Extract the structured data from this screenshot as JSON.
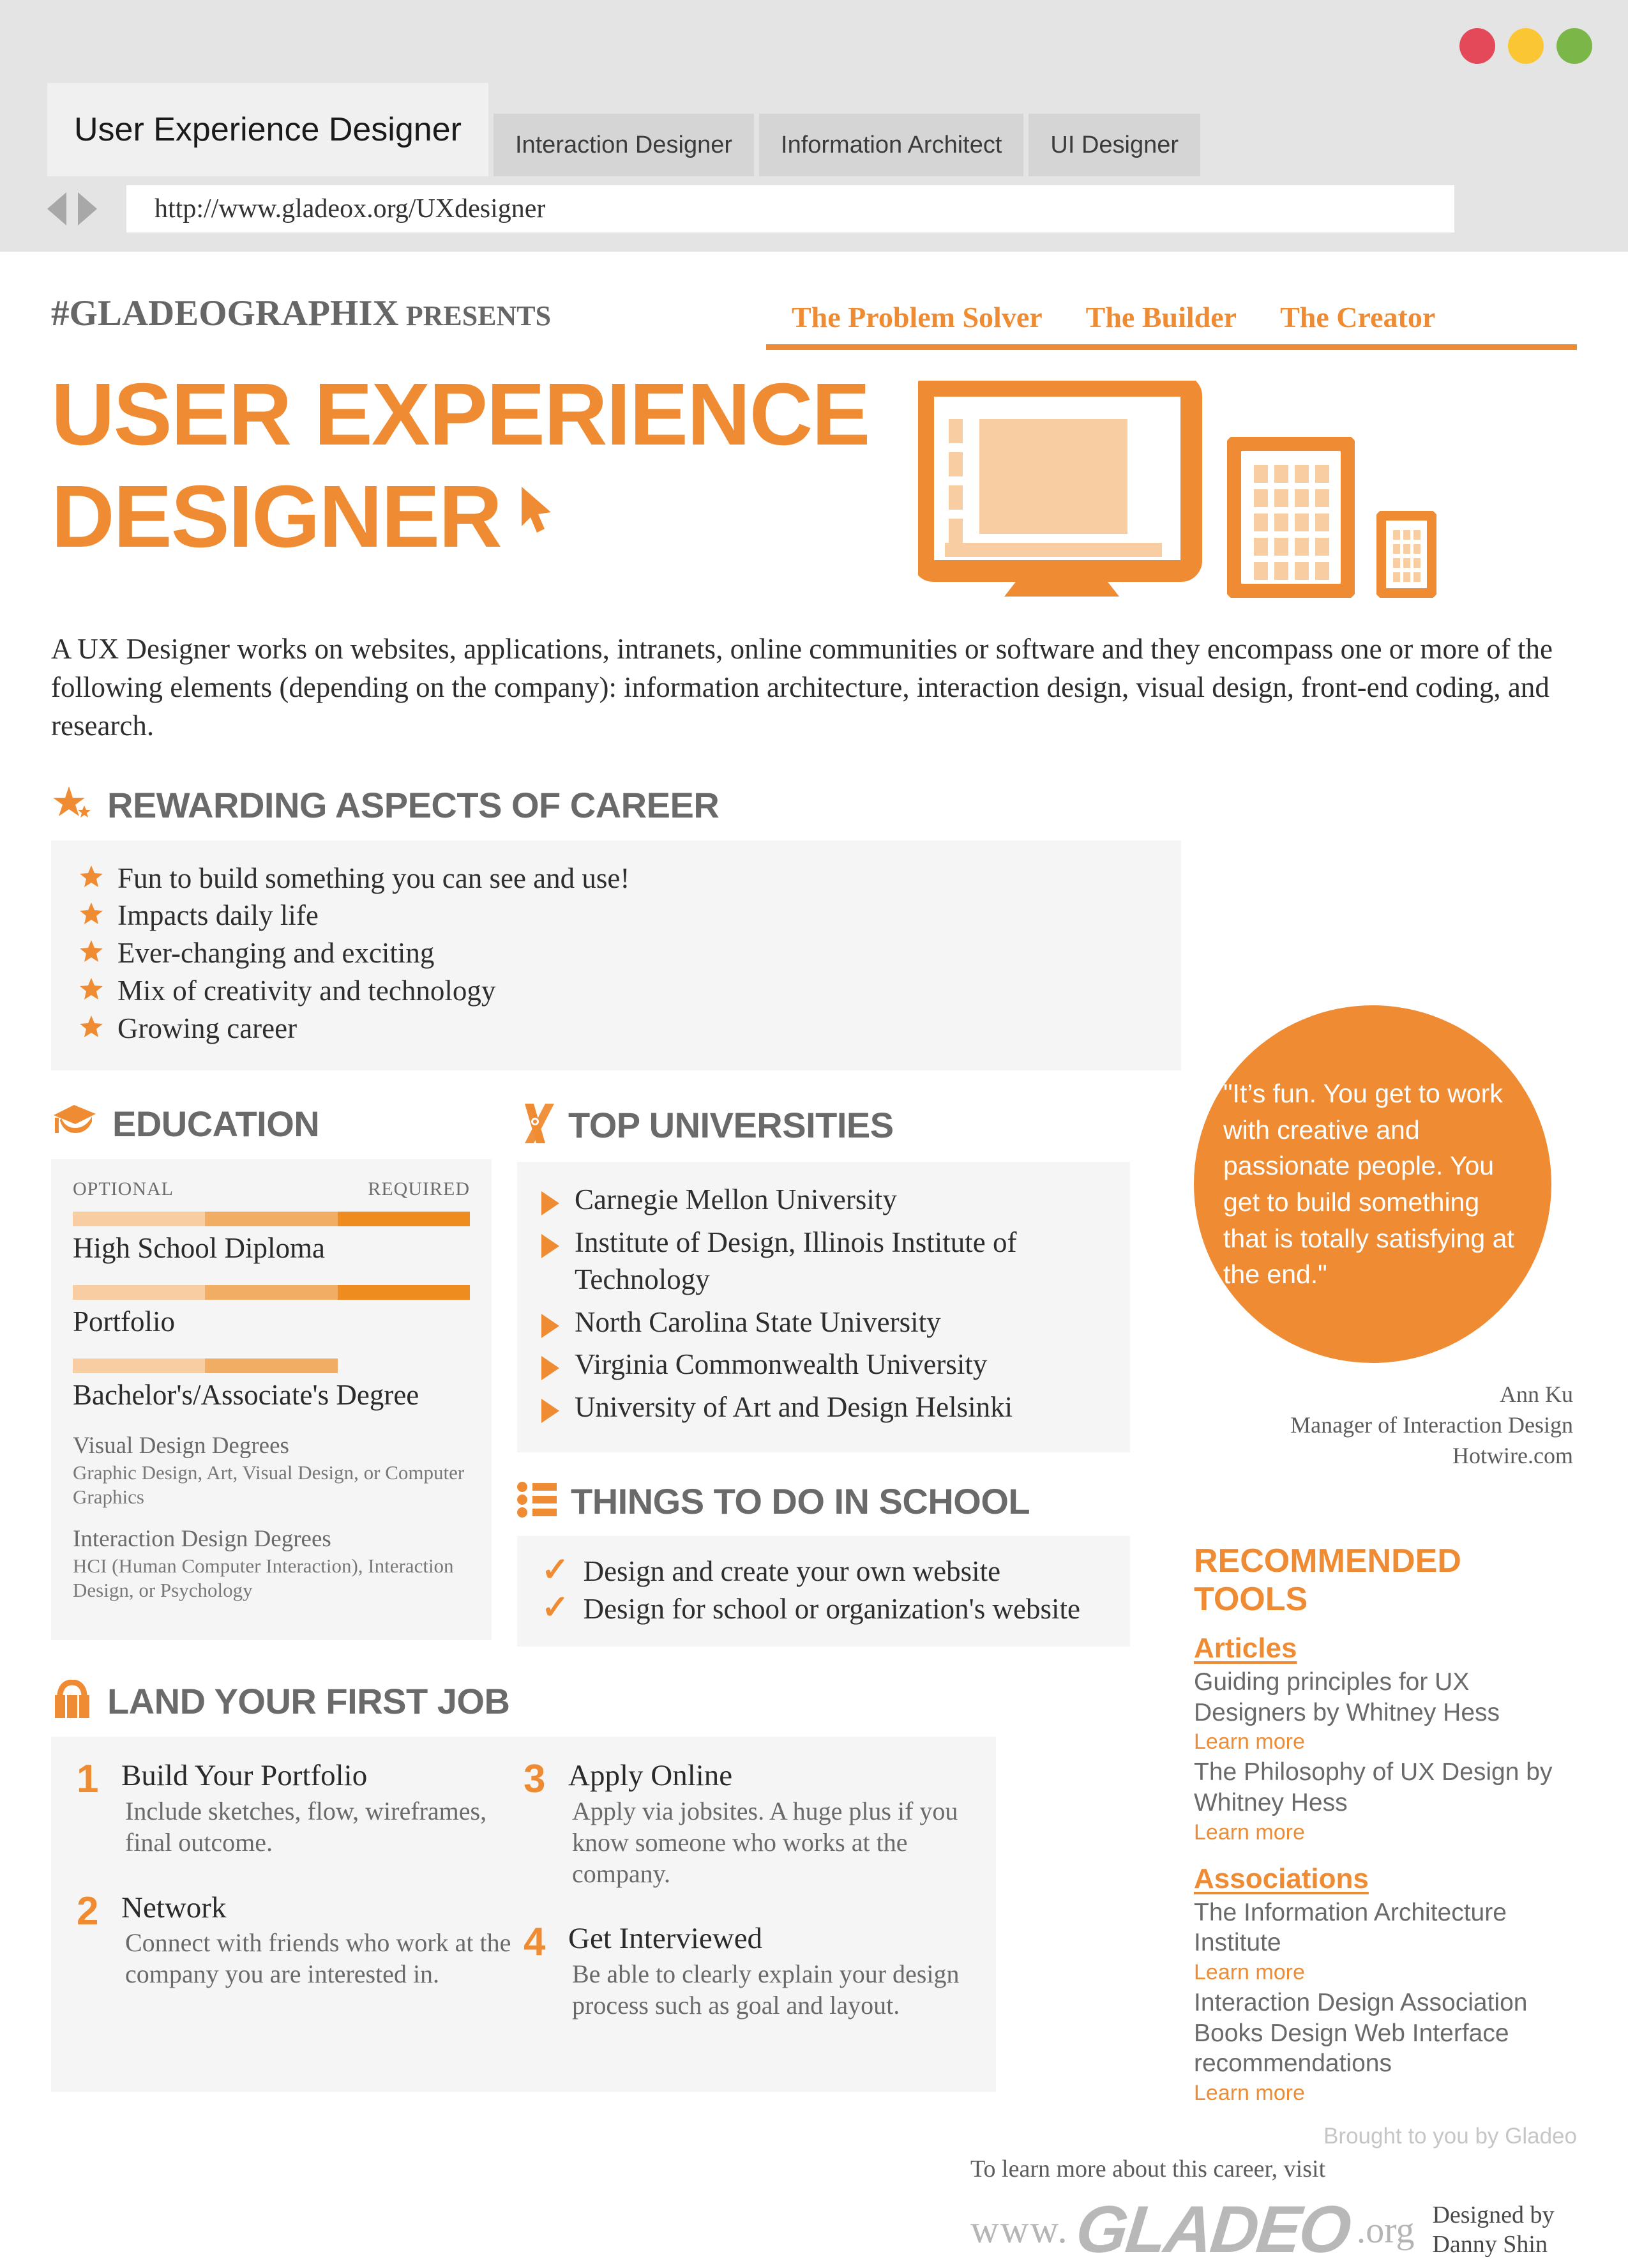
{
  "browser": {
    "tabs": [
      {
        "label": "User Experience Designer",
        "active": true
      },
      {
        "label": "Interaction Designer",
        "active": false
      },
      {
        "label": "Information Architect",
        "active": false
      },
      {
        "label": "UI Designer",
        "active": false
      }
    ],
    "url": "http://www.gladeox.org/UXdesigner",
    "window_controls": [
      "close-red",
      "minimize-yellow",
      "maximize-green"
    ]
  },
  "header": {
    "presents_brand": "#GLADEOGRAPHIX",
    "presents_word": "PRESENTS",
    "nav_links": [
      "The Problem Solver",
      "The Builder",
      "The Creator"
    ],
    "title_line1": "USER EXPERIENCE",
    "title_line2": "DESIGNER",
    "devices": [
      "monitor-icon",
      "tablet-icon",
      "phone-icon"
    ],
    "cursor": "cursor-arrow-icon"
  },
  "intro": "A UX Designer works on websites, applications, intranets, online communities or software and they encompass one or more of the following elements (depending on the company): information architecture, interaction design, visual design, front-end coding, and research.",
  "rewarding": {
    "icon": "star-icon",
    "heading": "REWARDING ASPECTS OF CAREER",
    "items": [
      "Fun to build something you can see and use!",
      "Impacts daily life",
      "Ever-changing and exciting",
      "Mix of creativity and technology",
      "Growing career"
    ]
  },
  "education": {
    "icon": "graduation-cap-icon",
    "heading": "EDUCATION",
    "scale_left": "OPTIONAL",
    "scale_right": "REQUIRED",
    "items": [
      {
        "label": "High School Diploma",
        "level": 3
      },
      {
        "label": "Portfolio",
        "level": 3
      },
      {
        "label": "Bachelor's/Associate's Degree",
        "level": 2
      }
    ],
    "degrees": [
      {
        "title": "Visual Design Degrees",
        "detail": "Graphic Design, Art, Visual Design, or Computer Graphics"
      },
      {
        "title": "Interaction Design Degrees",
        "detail": "HCI (Human Computer Interaction), Interaction Design, or Psychology"
      }
    ]
  },
  "universities": {
    "icon": "diploma-scroll-icon",
    "heading": "TOP UNIVERSITIES",
    "items": [
      "Carnegie Mellon University",
      "Institute of Design, Illinois Institute of Technology",
      "North Carolina State University",
      "Virginia Commonwealth University",
      "University of Art and Design Helsinki"
    ]
  },
  "school": {
    "icon": "list-bullets-icon",
    "heading": "THINGS TO DO IN SCHOOL",
    "items": [
      "Design and create your own website",
      "Design for school or organization's website"
    ],
    "check_glyph": "✓"
  },
  "quote": {
    "text": "\"It’s fun. You get to work with creative and passionate people. You get to build something that is totally satisfying at the end.\"",
    "author": "Ann Ku",
    "role": "Manager of Interaction Design",
    "company": "Hotwire.com"
  },
  "tools": {
    "title": "RECOMMENDED TOOLS",
    "sections": [
      {
        "label": "Articles",
        "entries": [
          {
            "text": "Guiding principles for UX Designers by Whitney Hess",
            "link": "Learn more"
          },
          {
            "text": "The Philosophy of UX Design by Whitney Hess",
            "link": "Learn more"
          }
        ]
      },
      {
        "label": "Associations",
        "entries": [
          {
            "text": "The Information Architecture Institute",
            "link": "Learn more"
          },
          {
            "text": "Interaction Design Association Books Design Web Interface recommendations",
            "link": "Learn more"
          }
        ]
      }
    ],
    "brought_by": "Brought to you by Gladeo"
  },
  "job": {
    "icon": "briefcase-icon",
    "heading": "LAND YOUR FIRST JOB",
    "steps": [
      {
        "num": "1",
        "title": "Build Your Portfolio",
        "desc": "Include sketches, flow, wireframes, final outcome."
      },
      {
        "num": "2",
        "title": "Network",
        "desc": "Connect with friends who work at the company you are interested in."
      },
      {
        "num": "3",
        "title": "Apply Online",
        "desc": "Apply via jobsites. A huge plus if you know someone who works at the company."
      },
      {
        "num": "4",
        "title": "Get Interviewed",
        "desc": "Be able to clearly explain your design process such as goal and layout."
      }
    ]
  },
  "footer": {
    "learn_more": "To learn more about this career, visit",
    "www": "www.",
    "brand": "GLADEO",
    "tld": ".org",
    "designed_by_line1": "Designed by",
    "designed_by_line2": "Danny Shin"
  },
  "colors": {
    "accent": "#ef8c33",
    "accent_light": "#f7cda1",
    "accent_mid": "#f0ad63",
    "heading_gray": "#6a6a6a",
    "body_gray": "#2e2e2e",
    "panel_bg": "#f5f5f5",
    "chrome_bg": "#e4e4e4"
  }
}
